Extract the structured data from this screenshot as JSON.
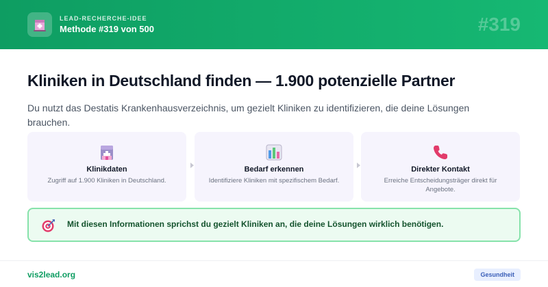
{
  "header": {
    "logo_icon": "hospital-building-icon",
    "eyebrow": "LEAD-RECHERCHE-IDEE",
    "method_label": "Methode #319 von 500",
    "number": "#319"
  },
  "main": {
    "title": "Kliniken in Deutschland finden — 1.900 potenzielle Partner",
    "description": "Du nutzt das Destatis Krankenhausverzeichnis, um gezielt Kliniken zu identifizieren, die deine Lösungen brauchen.",
    "cards": [
      {
        "icon": "hospital-icon",
        "title": "Klinikdaten",
        "text": "Zugriff auf 1.900 Kliniken in Deutschland."
      },
      {
        "icon": "bar-chart-icon",
        "title": "Bedarf erkennen",
        "text": "Identifiziere Kliniken mit spezifischem Bedarf."
      },
      {
        "icon": "telephone-icon",
        "title": "Direkter Kontakt",
        "text": "Erreiche Entscheidungsträger direkt für Angebote."
      }
    ],
    "callout": {
      "icon": "target-icon",
      "text": "Mit diesen Informationen sprichst du gezielt Kliniken an, die deine Lösungen wirklich benötigen."
    }
  },
  "footer": {
    "site": "vis2lead.org",
    "tag": "Gesundheit"
  },
  "colors": {
    "brand_green": "#0e9d62",
    "card_bg": "#f6f4fd",
    "callout_bg": "#ecfbf1",
    "callout_border": "#86e2aa",
    "tag_bg": "#e8efff"
  }
}
